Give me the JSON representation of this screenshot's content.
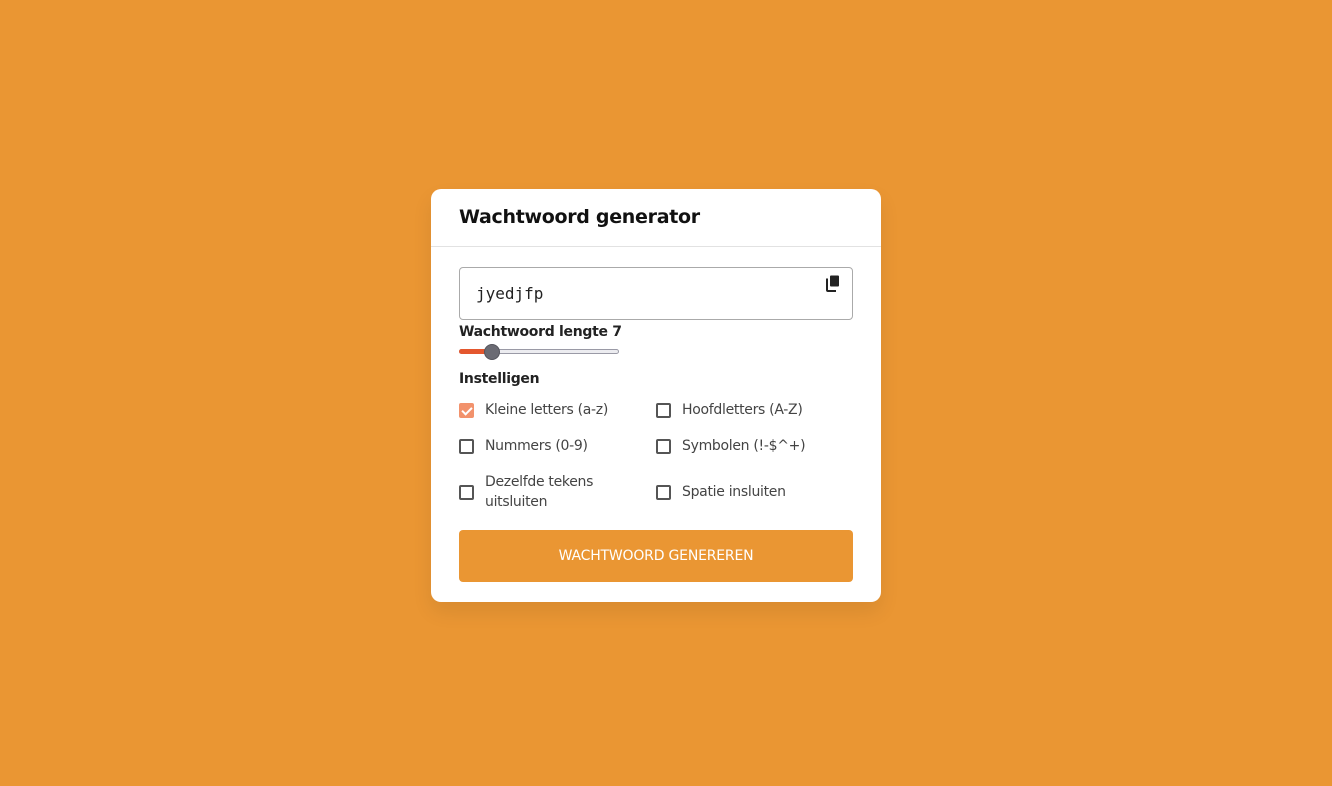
{
  "colors": {
    "background": "#EA9633",
    "accent": "#E4572E",
    "checkbox_checked": "#F2926C",
    "button": "#EA9633"
  },
  "card": {
    "title": "Wachtwoord generator"
  },
  "password": {
    "value": "jyedjfp",
    "copy_icon": "copy-icon"
  },
  "length": {
    "label": "Wachtwoord lengte 7",
    "value": 7,
    "min": 1,
    "max": 30
  },
  "settings": {
    "title": "Instelligen",
    "options": [
      {
        "label": "Kleine letters (a-z)",
        "checked": true
      },
      {
        "label": "Hoofdletters (A-Z)",
        "checked": false
      },
      {
        "label": "Nummers (0-9)",
        "checked": false
      },
      {
        "label": "Symbolen (!-$^+)",
        "checked": false
      },
      {
        "label": "Dezelfde tekens uitsluiten",
        "checked": false
      },
      {
        "label": "Spatie insluiten",
        "checked": false
      }
    ]
  },
  "generate_button": {
    "label": "WACHTWOORD GENEREREN"
  }
}
